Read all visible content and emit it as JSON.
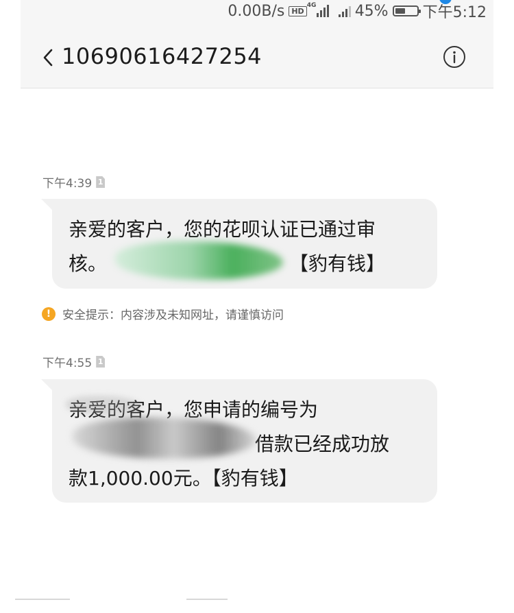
{
  "status_bar": {
    "net_speed": "0.00B/s",
    "hd_label": "HD",
    "net_type": "4G",
    "battery": "45%",
    "battery_level": 0.45,
    "time": "下午5:12"
  },
  "header": {
    "back_icon": "chevron-left",
    "contact_number": "10690616427254",
    "info_icon": "info-circle"
  },
  "messages": [
    {
      "time": "下午4:39",
      "sim_label": "1",
      "line1": "亲爱的客户，您的花呗认证已通过审",
      "line2_prefix": "核。",
      "line2_suffix": "【豹有钱】",
      "redaction_color": "#4caf50"
    },
    {
      "time": "下午4:55",
      "sim_label": "1",
      "line1": "亲爱的客户，您申请的编号为",
      "line2_suffix": "借款已经成功放",
      "line3": "款1,000.00元。【豹有钱】",
      "redaction_color": "#8a8a8a"
    }
  ],
  "security_warning": {
    "icon": "warning-circle",
    "icon_glyph": "!",
    "text": "安全提示：内容涉及未知网址，请谨慎访问",
    "color": "#f5a623"
  }
}
